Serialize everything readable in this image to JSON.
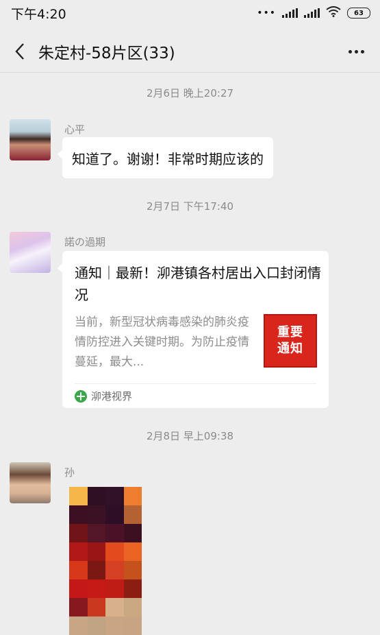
{
  "status_bar": {
    "time": "下午4:20",
    "battery": "63"
  },
  "nav": {
    "title": "朱定村-58片区(33)"
  },
  "messages": [
    {
      "timestamp": "2月6日 晚上20:27",
      "sender": "心平",
      "text": "知道了。谢谢！非常时期应该的"
    },
    {
      "timestamp": "2月7日 下午17:40",
      "sender": "諾の過期",
      "card": {
        "title": "通知｜最新！泖港镇各村居出入口封闭情况",
        "desc": "当前，新型冠状病毒感染的肺炎疫情防控进入关键时期。为防止疫情蔓延，最大...",
        "thumb_line1": "重要",
        "thumb_line2": "通知",
        "source": "泖港视界"
      }
    },
    {
      "timestamp": "2月8日 早上09:38",
      "sender": "孙",
      "image_pixels": [
        "#f5b64a",
        "#2e0f24",
        "#2f1227",
        "#ee7d2d",
        "#3c1022",
        "#3b1124",
        "#2e0e26",
        "#b46232",
        "#701418",
        "#531628",
        "#4a1127",
        "#3c1020",
        "#b11818",
        "#9a1616",
        "#e24a1d",
        "#ea6322",
        "#d8381a",
        "#7a1814",
        "#d53f23",
        "#c5521c",
        "#c31818",
        "#c61b14",
        "#c01c16",
        "#8b1d12",
        "#871820",
        "#c8371e",
        "#d9b08c",
        "#c9a882",
        "#c7a585",
        "#bfa383",
        "#c9a584",
        "#c8a483"
      ]
    }
  ]
}
